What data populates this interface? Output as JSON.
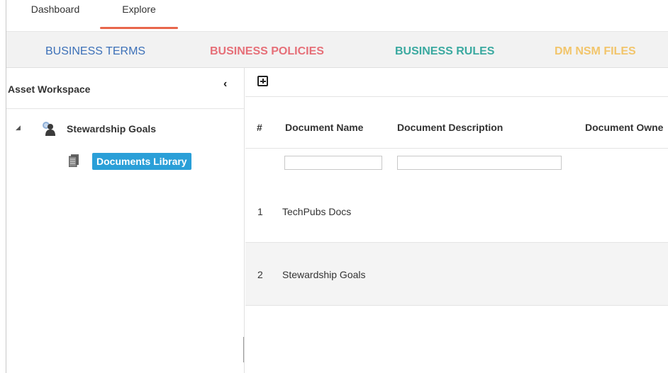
{
  "top_tabs": [
    {
      "label": "Dashboard",
      "active": false
    },
    {
      "label": "Explore",
      "active": true
    }
  ],
  "business_tabs": {
    "terms": {
      "label": "BUSINESS TERMS",
      "color": "#3c70b8"
    },
    "policies": {
      "label": "BUSINESS POLICIES",
      "color": "#e66f78"
    },
    "rules": {
      "label": "BUSINESS RULES",
      "color": "#3aa9a0"
    },
    "nsm": {
      "label": "DM NSM FILES",
      "color": "#f2c56b"
    }
  },
  "workspace": {
    "title": "Asset Workspace",
    "collapse_icon": "chevron-left-icon",
    "tree": {
      "root": {
        "label": "Stewardship Goals",
        "icon": "people-icon",
        "expanded": true
      },
      "child": {
        "label": "Documents Library",
        "icon": "document-icon",
        "selected": true,
        "highlight_color": "#2a9fd8"
      }
    }
  },
  "grid": {
    "toolbar": {
      "add_icon": "plus-square-icon"
    },
    "columns": {
      "num": "#",
      "name": "Document Name",
      "description": "Document Description",
      "owner": "Document Owne"
    },
    "rows": [
      {
        "num": "1",
        "name": "TechPubs Docs"
      },
      {
        "num": "2",
        "name": "Stewardship Goals"
      }
    ]
  }
}
